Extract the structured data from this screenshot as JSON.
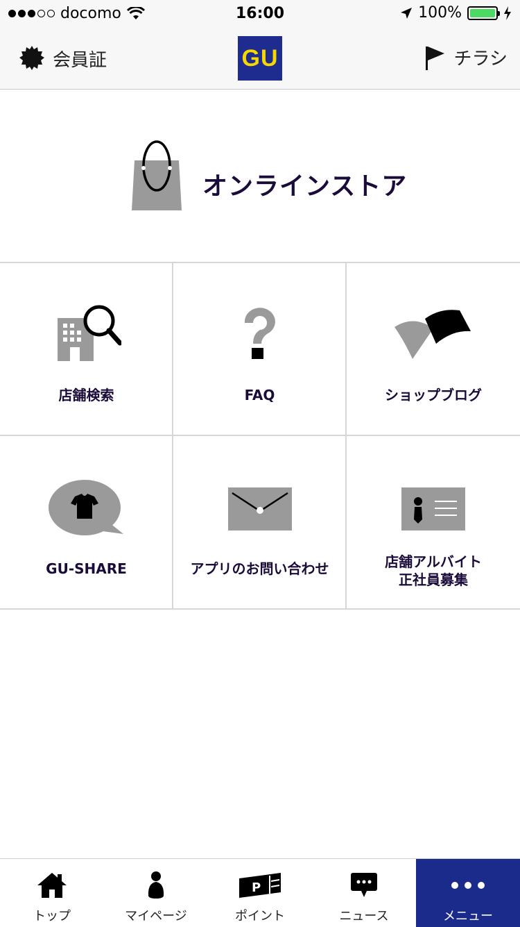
{
  "status_bar": {
    "carrier": "docomo",
    "time": "16:00",
    "battery": "100%"
  },
  "nav": {
    "left_label": "会員証",
    "logo_text": "GU",
    "right_label": "チラシ"
  },
  "banner": {
    "label": "オンラインストア"
  },
  "grid": {
    "items": [
      {
        "label": "店舗検索"
      },
      {
        "label": "FAQ"
      },
      {
        "label": "ショップブログ"
      },
      {
        "label": "GU-SHARE"
      },
      {
        "label": "アプリのお問い合わせ"
      },
      {
        "label_line1": "店舗アルバイト",
        "label_line2": "正社員募集"
      }
    ]
  },
  "tabs": [
    {
      "label": "トップ",
      "icon": "home-icon"
    },
    {
      "label": "マイページ",
      "icon": "person-icon"
    },
    {
      "label": "ポイント",
      "icon": "point-card-icon"
    },
    {
      "label": "ニュース",
      "icon": "chat-bubble-icon"
    },
    {
      "label": "メニュー",
      "icon": "more-dots-icon",
      "active": true
    }
  ],
  "colors": {
    "brand_blue": "#1e2b8f",
    "brand_yellow": "#f6d800",
    "text_dark": "#1b0b3a",
    "icon_gray": "#999999",
    "battery_green": "#4cd964"
  }
}
